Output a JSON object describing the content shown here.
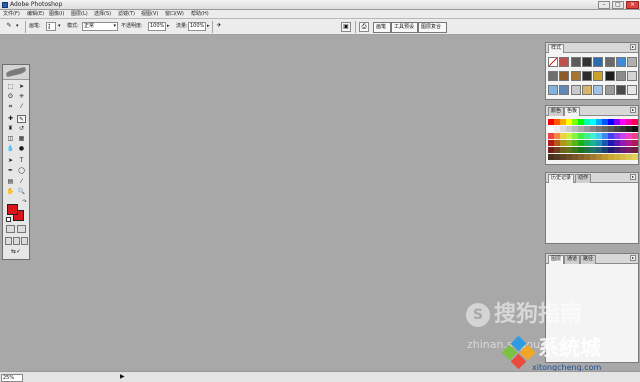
{
  "window": {
    "title": "Adobe Photoshop"
  },
  "menu": [
    "文件(F)",
    "编辑(E)",
    "图像(I)",
    "图层(L)",
    "选择(S)",
    "滤镜(T)",
    "视图(V)",
    "窗口(W)",
    "帮助(H)"
  ],
  "options": {
    "brush_label": "画笔:",
    "brush_size": "4",
    "mode_label": "模式:",
    "mode_value": "正常",
    "opacity_label": "不透明度:",
    "opacity_value": "100%",
    "flow_label": "流量:",
    "flow_value": "100%"
  },
  "well_tabs": [
    "画笔",
    "工具预设",
    "图层复合"
  ],
  "panels": {
    "styles": {
      "tab": "样式"
    },
    "swatches": {
      "tabs": [
        "颜色",
        "色板"
      ]
    },
    "history": {
      "tabs": [
        "历史记录",
        "动作"
      ]
    },
    "layers": {
      "tabs": [
        "图层",
        "通道",
        "路径"
      ]
    }
  },
  "colors": {
    "foreground": "#d9141a",
    "background": "#d9141a",
    "workspace": "#a8a8a8"
  },
  "status": {
    "zoom": "25%"
  },
  "watermark": {
    "line1": "搜狗指南",
    "line2": "zhinan.sogou.com",
    "line3": "系统城",
    "line4": "xitongcheng.com"
  }
}
